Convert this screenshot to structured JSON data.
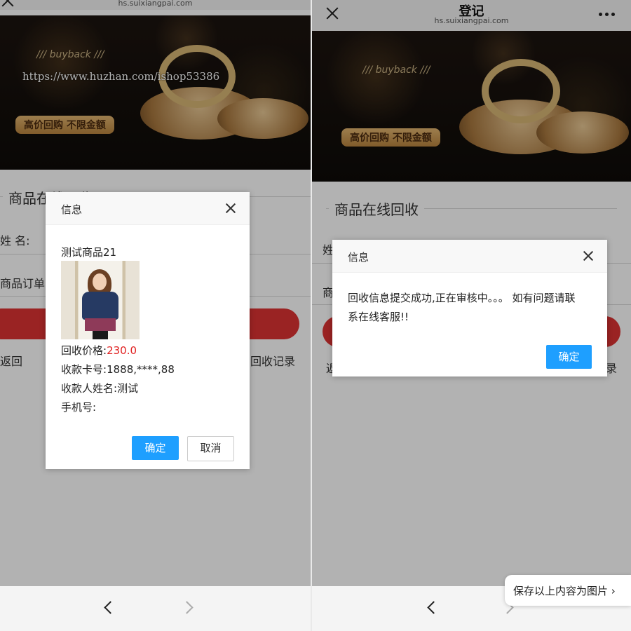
{
  "left": {
    "url": "hs.suixiangpai.com",
    "banner": {
      "buyback_text": "/// buyback ///",
      "slogan": "高价回购  不限金额",
      "watermark": "https://www.huzhan.com/ishop53386"
    },
    "page": {
      "section_title": "商品在线回收",
      "field_name_label": "姓 名:",
      "field_order_label": "商品订单号",
      "back_link": "返回",
      "records_link": "回收记录"
    },
    "dialog": {
      "title": "信息",
      "product_name": "测试商品21",
      "price_label": "回收价格:",
      "price_value": "230.0",
      "card_label": "收款卡号:",
      "card_value": "1888,****,88",
      "payee_label": "收款人姓名:",
      "payee_value": "测试",
      "phone_label": "手机号:",
      "ok_label": "确定",
      "cancel_label": "取消"
    }
  },
  "right": {
    "title": "登记",
    "url": "hs.suixiangpai.com",
    "banner": {
      "buyback_text": "/// buyback ///",
      "slogan": "高价回购  不限金额"
    },
    "page": {
      "section_title": "商品在线回收",
      "field_name_label": "姓",
      "field_order_label": "商",
      "back_link": "返",
      "records_link": "录"
    },
    "dialog": {
      "title": "信息",
      "message_line1": "回收信息提交成功,正在审核中。。。 如有问题请联",
      "message_line2": "系在线客服!!",
      "ok_label": "确定"
    },
    "save_tip": "保存以上内容为图片 ›"
  },
  "colors": {
    "primary_button": "#1e9fff",
    "price_text": "#e02020",
    "action_bar": "#d33333"
  }
}
